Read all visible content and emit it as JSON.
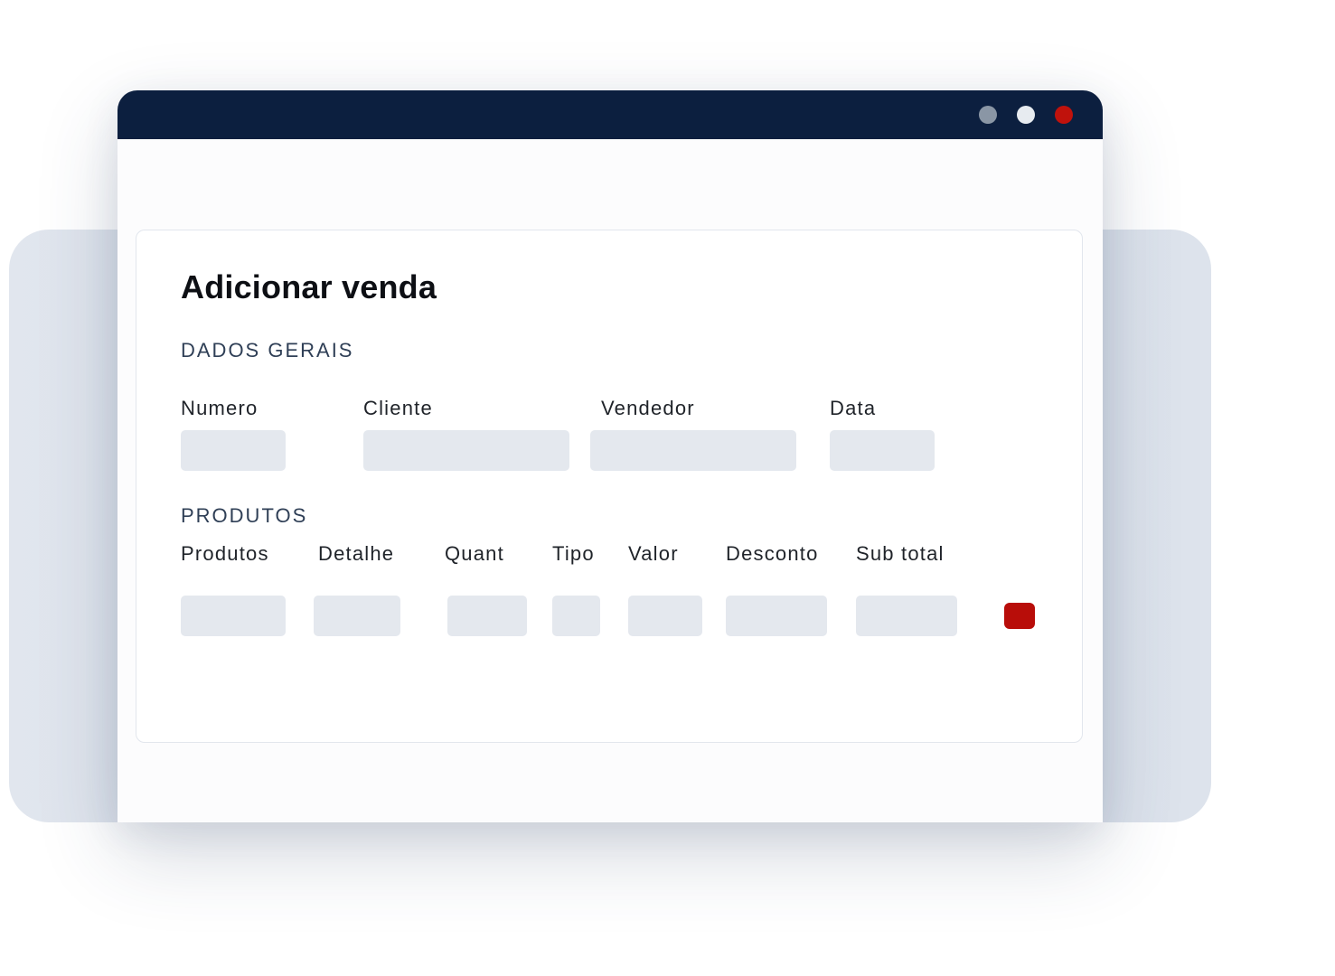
{
  "colors": {
    "titlebar": "#0c1f3f",
    "dot_minimize": "#8a96a5",
    "dot_maximize": "#e7ebf0",
    "dot_close": "#c0120c",
    "field_fill": "#e4e8ee",
    "delete_button": "#b80d09"
  },
  "icons": {
    "delete": "remove-row-button"
  },
  "form": {
    "title": "Adicionar venda",
    "general_section": {
      "heading": "DADOS GERAIS",
      "fields": [
        {
          "label": "Numero",
          "value": ""
        },
        {
          "label": "Cliente",
          "value": ""
        },
        {
          "label": "Vendedor",
          "value": ""
        },
        {
          "label": "Data",
          "value": ""
        }
      ]
    },
    "products_section": {
      "heading": "PRODUTOS",
      "columns": [
        "Produtos",
        "Detalhe",
        "Quant",
        "Tipo",
        "Valor",
        "Desconto",
        "Sub total"
      ],
      "rows": [
        [
          "",
          "",
          "",
          "",
          "",
          "",
          ""
        ]
      ]
    }
  }
}
